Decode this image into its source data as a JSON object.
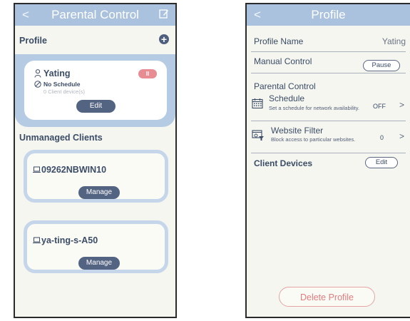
{
  "left": {
    "header": {
      "back": "<",
      "title": "Parental Control"
    },
    "profile_section": {
      "label": "Profile",
      "add": "+"
    },
    "profile_card": {
      "name": "Yating",
      "pause_badge": "II",
      "schedule": "No Schedule",
      "clients": "0 Client device(s)",
      "edit": "Edit"
    },
    "unmanaged": {
      "label": "Unmanaged Clients",
      "clients": [
        {
          "name": "09262NBWIN10",
          "action": "Manage"
        },
        {
          "name": "ya-ting-s-A50",
          "action": "Manage"
        }
      ]
    }
  },
  "right": {
    "header": {
      "back": "<",
      "title": "Profile"
    },
    "profile_name": {
      "label": "Profile Name",
      "value": "Yating"
    },
    "manual_control": {
      "label": "Manual Control",
      "button": "Pause"
    },
    "parental_control": {
      "label": "Parental Control",
      "schedule": {
        "title": "Schedule",
        "desc": "Set a schedule for network availability.",
        "value": "OFF",
        "chevron": ">"
      },
      "website_filter": {
        "title": "Website Filter",
        "desc": "Block access to particular websites.",
        "value": "0",
        "chevron": ">"
      }
    },
    "client_devices": {
      "label": "Client Devices",
      "button": "Edit"
    },
    "delete": "Delete Profile"
  },
  "colors": {
    "header": "#aac2dd",
    "accent": "#536483",
    "danger": "#e07c80",
    "pause": "#e88c93"
  }
}
